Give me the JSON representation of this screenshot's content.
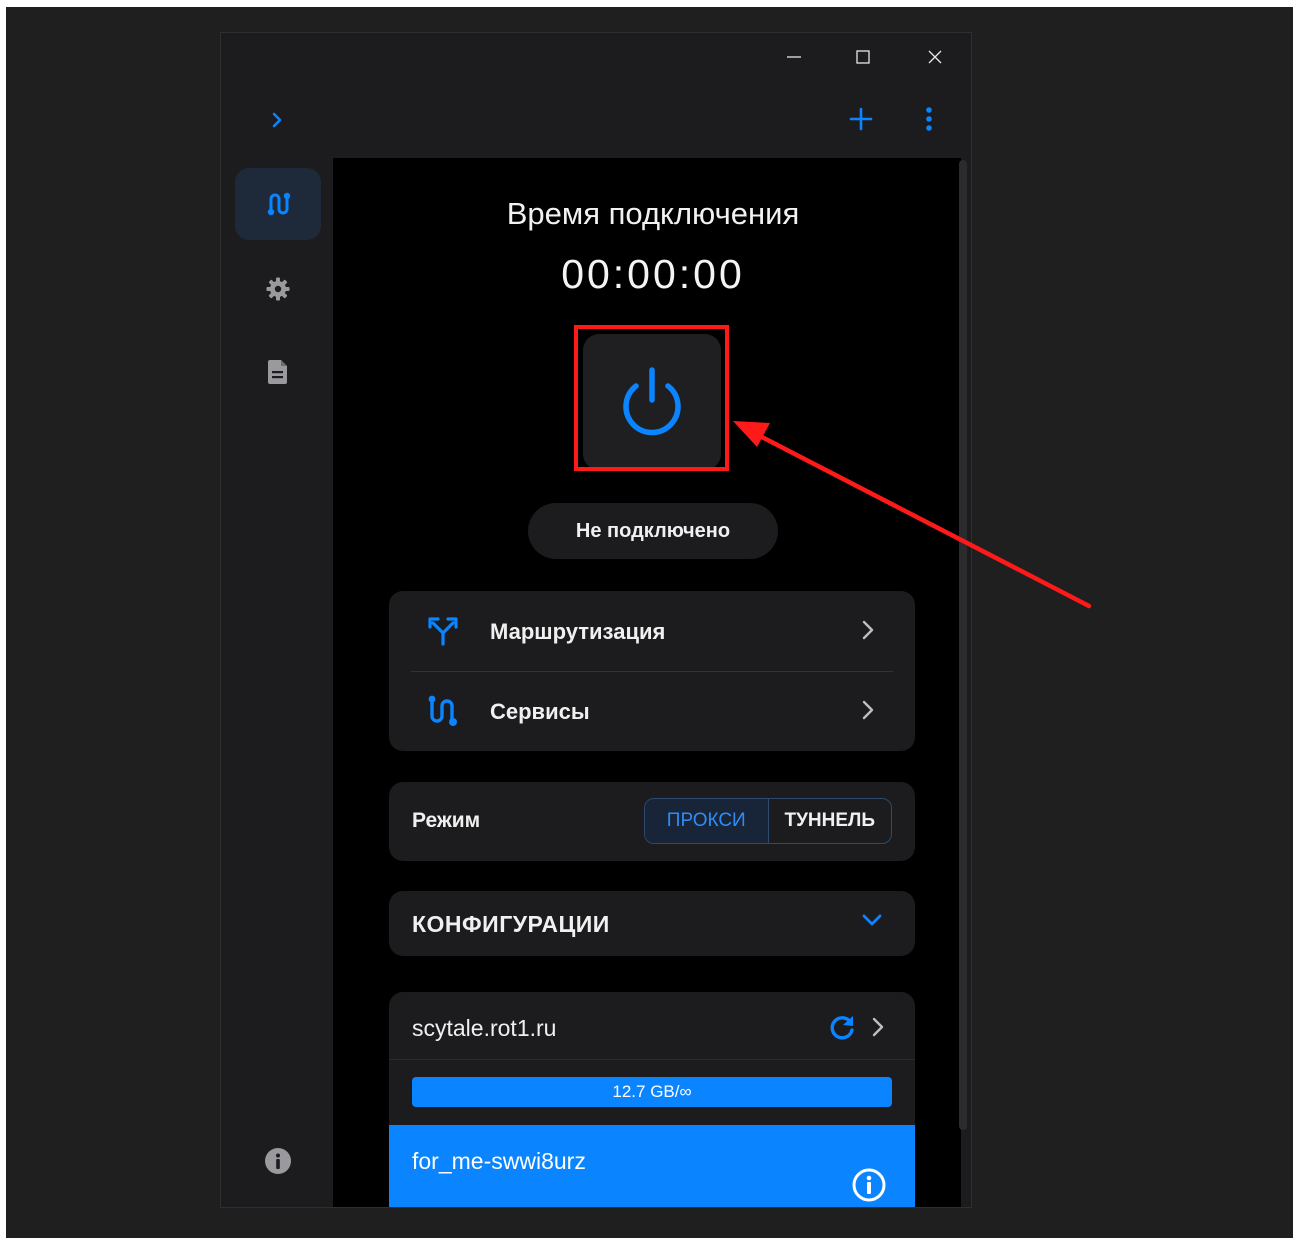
{
  "window": {
    "controls": [
      "minimize",
      "maximize",
      "close"
    ]
  },
  "topbar": {
    "expand_icon": "chevron-right-icon",
    "add_icon": "plus-icon",
    "menu_icon": "more-vertical-icon"
  },
  "sidebar": {
    "items": [
      {
        "name": "routes",
        "icon": "route-icon",
        "active": true
      },
      {
        "name": "settings",
        "icon": "gear-icon",
        "active": false
      },
      {
        "name": "logs",
        "icon": "document-icon",
        "active": false
      },
      {
        "name": "info",
        "icon": "info-icon",
        "active": false
      }
    ]
  },
  "main": {
    "connection_title": "Время подключения",
    "connection_time": "00:00:00",
    "power_icon": "power-icon",
    "status": "Не подключено"
  },
  "nav": {
    "routing_label": "Маршрутизация",
    "services_label": "Сервисы"
  },
  "mode": {
    "label": "Режим",
    "options": [
      "ПРОКСИ",
      "ТУННЕЛЬ"
    ],
    "selected": "ПРОКСИ"
  },
  "configs": {
    "label": "КОНФИГУРАЦИИ"
  },
  "profile": {
    "name": "scytale.rot1.ru",
    "traffic": "12.7 GB/∞",
    "config_name": "for_me-swwi8urz"
  },
  "colors": {
    "accent": "#0a84ff",
    "annotation": "#ff1a1a",
    "background": "#1c1c1e"
  }
}
